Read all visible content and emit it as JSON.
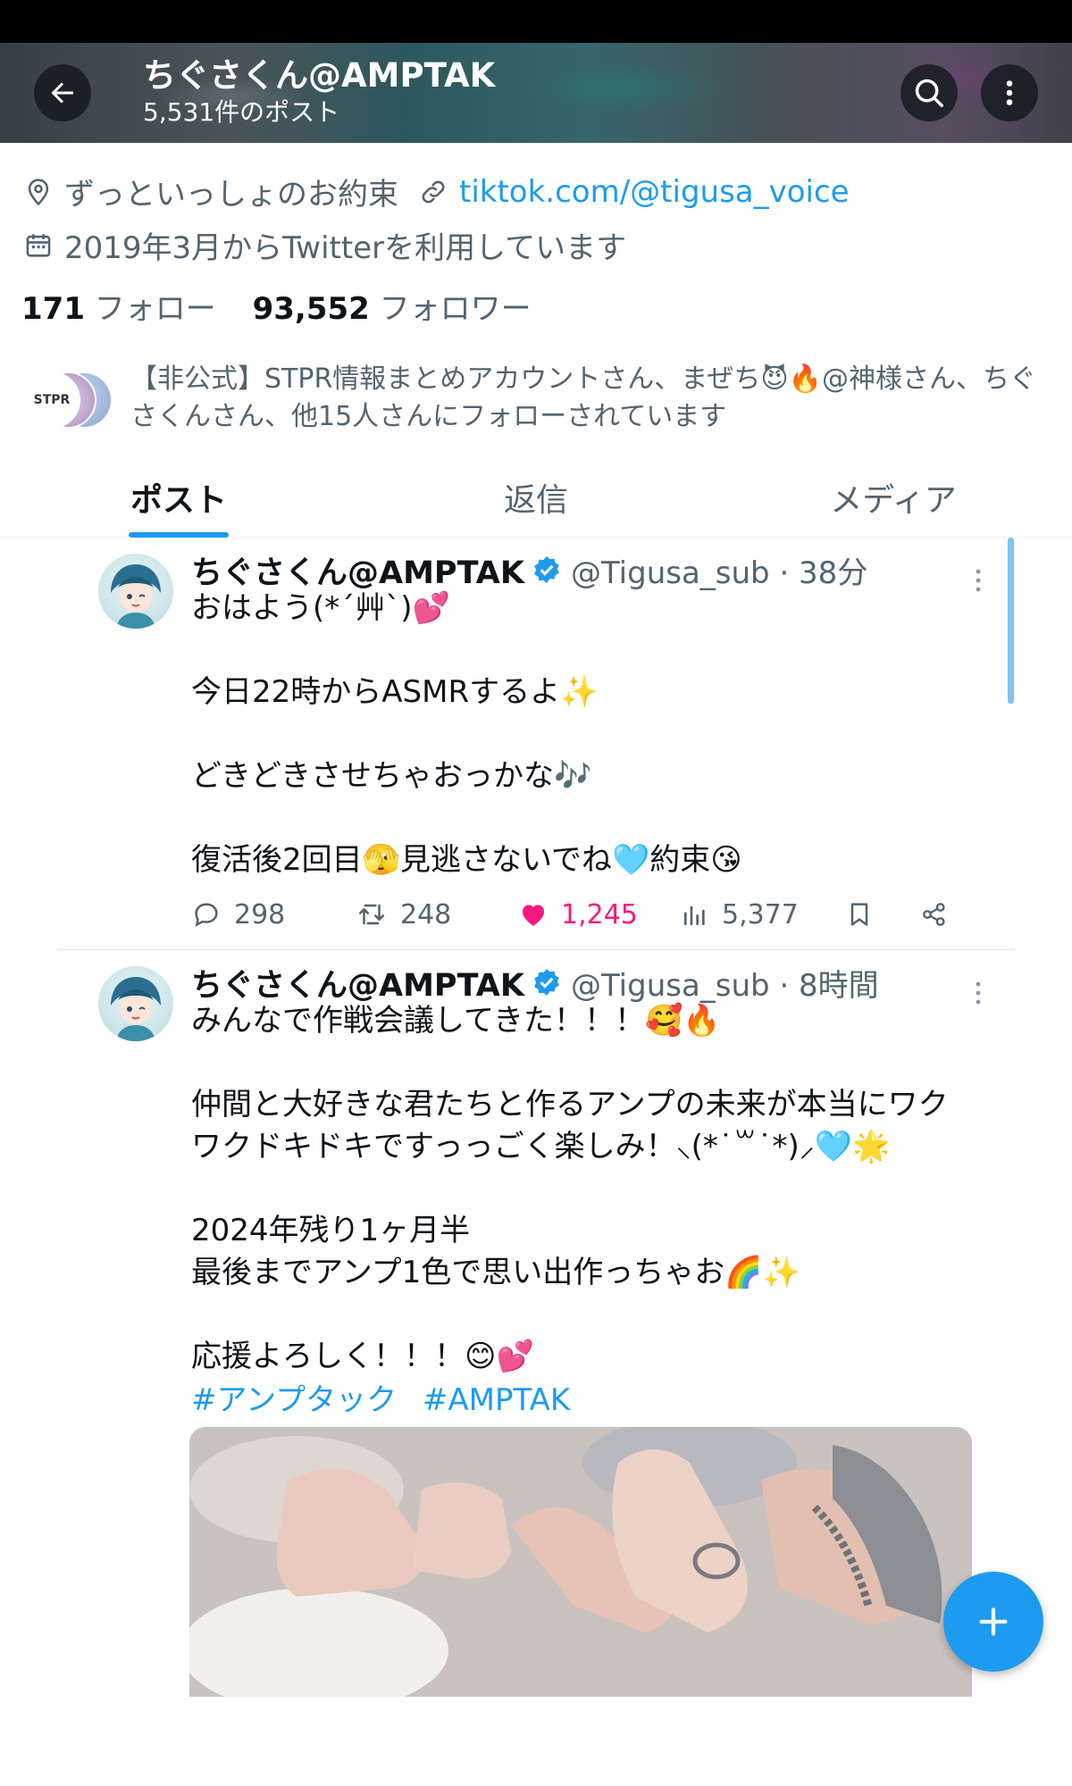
{
  "header": {
    "name": "ちぐさくん@AMPTAK",
    "post_count": "5,531件のポスト",
    "back_icon": "arrow-left-icon",
    "search_icon": "search-icon",
    "more_icon": "more-vertical-icon"
  },
  "profile": {
    "location": "ずっといっしょのお約束",
    "website": "tiktok.com/@tigusa_voice",
    "joined": "2019年3月からTwitterを利用しています",
    "following_count": "171",
    "following_label": "フォロー",
    "followers_count": "93,552",
    "followers_label": "フォロワー",
    "followed_by": "【非公式】STPR情報まとめアカウントさん、まぜち😈🔥@神様さん、ちぐさくんさん、他15人さんにフォローされています",
    "followed_by_avatar_text": "STPR"
  },
  "tabs": [
    {
      "label": "ポスト",
      "active": true
    },
    {
      "label": "返信",
      "active": false
    },
    {
      "label": "メディア",
      "active": false
    }
  ],
  "tweets": [
    {
      "name": "ちぐさくん@AMPTAK",
      "handle": "@Tigusa_sub · 38分",
      "text": "おはよう(*´艸`)💕\n\n今日22時からASMRするよ✨\n\nどきどきさせちゃおっかな🎶\n\n復活後2回目🫣見逃さないでね🩵約束😘",
      "replies": "298",
      "retweets": "248",
      "likes": "1,245",
      "views": "5,377"
    },
    {
      "name": "ちぐさくん@AMPTAK",
      "handle": "@Tigusa_sub · 8時間",
      "text": "みんなで作戦会議してきた！！！🥰🔥\n\n仲間と大好きな君たちと作るアンプの未来が本当にワクワクドキドキですっっごく楽しみ！⸜(*˙꒳˙*)⸝🩵🌟\n\n2024年残り1ヶ月半\n最後までアンプ1色で思い出作っちゃお🌈✨\n\n応援よろしく！！！😊💕",
      "hashtags": [
        "#アンプタック",
        "#AMPTAK"
      ]
    }
  ],
  "colors": {
    "accent": "#1d9bf0",
    "like": "#f91880",
    "secondary_text": "#536471"
  },
  "fab": {
    "icon": "plus-icon"
  }
}
